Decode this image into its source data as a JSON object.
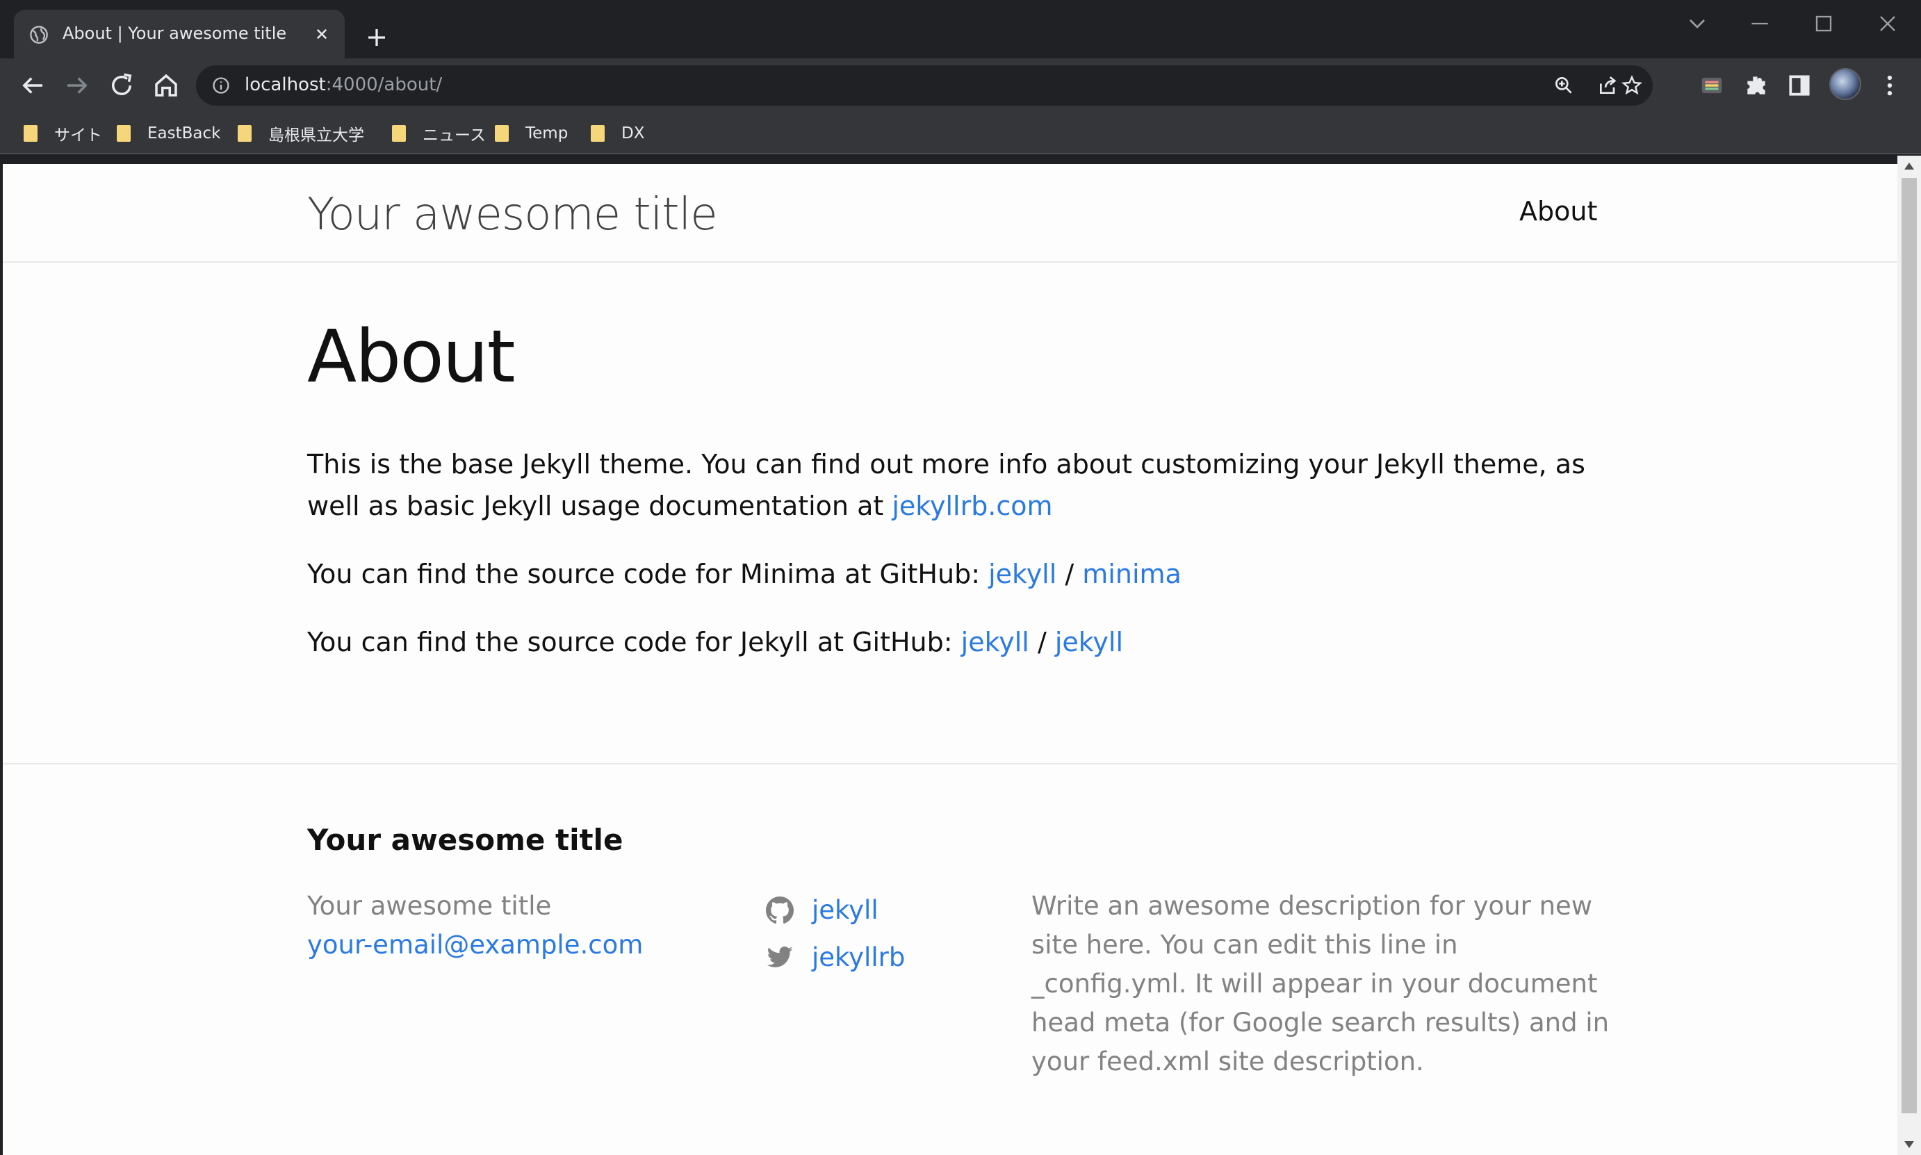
{
  "browser": {
    "tab_title": "About | Your awesome title",
    "url_host": "localhost",
    "url_path": ":4000/about/",
    "bookmarks": [
      "サイト",
      "EastBack",
      "島根県立大学",
      "ニュース",
      "Temp",
      "DX"
    ]
  },
  "header": {
    "site_title": "Your awesome title",
    "nav_about": "About"
  },
  "main": {
    "title": "About",
    "p1_text": "This is the base Jekyll theme. You can find out more info about customizing your Jekyll theme, as well as basic Jekyll usage documentation at ",
    "p1_link": "jekyllrb.com",
    "p2_text": "You can find the source code for Minima at GitHub: ",
    "p2_link1": "jekyll",
    "p2_sep": " / ",
    "p2_link2": "minima",
    "p3_text": "You can find the source code for Jekyll at GitHub: ",
    "p3_link1": "jekyll",
    "p3_sep": " / ",
    "p3_link2": "jekyll"
  },
  "footer": {
    "heading": "Your awesome title",
    "name": "Your awesome title",
    "email": "your-email@example.com",
    "github_user": "jekyll",
    "twitter_user": "jekyllrb",
    "description": "Write an awesome description for your new site here. You can edit this line in _config.yml. It will appear in your document head meta (for Google search results) and in your feed.xml site description."
  },
  "colors": {
    "link": "#2a7ae2",
    "muted_text": "#828282",
    "chrome_dark": "#202124",
    "chrome_toolbar": "#35363a"
  },
  "icons": [
    "globe-icon",
    "close-icon",
    "plus-icon",
    "back-icon",
    "forward-icon",
    "reload-icon",
    "home-icon",
    "info-icon",
    "zoom-icon",
    "share-icon",
    "star-icon",
    "extensions-icon",
    "sidepanel-icon",
    "menu-icon",
    "github-icon",
    "twitter-icon",
    "folder-icon"
  ]
}
